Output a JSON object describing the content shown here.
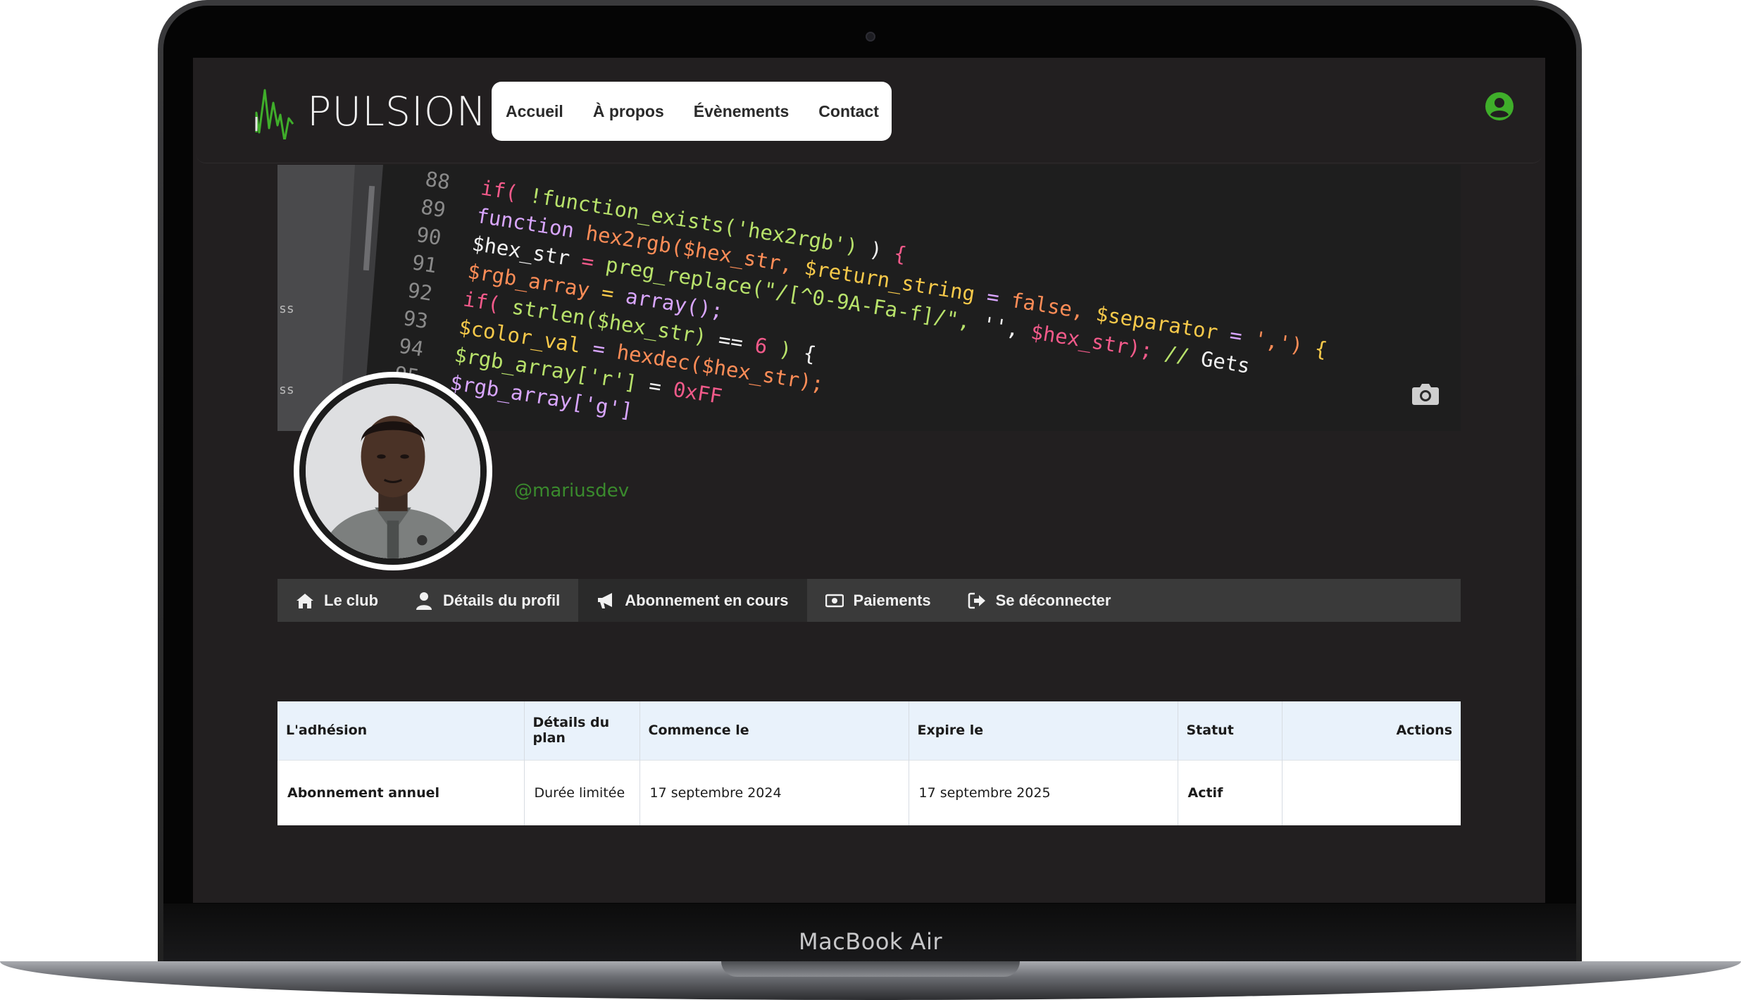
{
  "device": {
    "label": "MacBook Air"
  },
  "brand": {
    "logo_text": "PULSION",
    "accent_color": "#3fae2a"
  },
  "nav": {
    "items": [
      "Accueil",
      "À propos",
      "Évènements",
      "Contact"
    ],
    "user_icon": "user-circle-icon"
  },
  "banner": {
    "camera_icon": "camera-icon",
    "code_lines": [
      {
        "n": "88",
        "t": "if( !function_exists('hex2rgb') ) {"
      },
      {
        "n": "89",
        "t": "  function hex2rgb($hex_str, $return_string = false, $separator = ',') {"
      },
      {
        "n": "90",
        "t": "    $hex_str = preg_replace(\"/[^0-9A-Fa-f]/\", '', $hex_str); // Gets"
      },
      {
        "n": "91",
        "t": "    $rgb_array = array();"
      },
      {
        "n": "92",
        "t": "    if( strlen($hex_str) == 6 ) {"
      },
      {
        "n": "93",
        "t": "      $color_val = hexdec($hex_str);"
      },
      {
        "n": "94",
        "t": "      $rgb_array['r'] = 0xFF"
      },
      {
        "n": "95",
        "t": "      $rgb_array['g']"
      }
    ]
  },
  "profile": {
    "handle": "@mariusdev"
  },
  "tabs": [
    {
      "label": "Le club",
      "icon": "home-icon"
    },
    {
      "label": "Détails du profil",
      "icon": "user-icon"
    },
    {
      "label": "Abonnement en cours",
      "icon": "megaphone-icon",
      "active": true
    },
    {
      "label": "Paiements",
      "icon": "money-icon"
    },
    {
      "label": "Se déconnecter",
      "icon": "logout-icon"
    }
  ],
  "table": {
    "headers": [
      "L'adhésion",
      "Détails du plan",
      "Commence le",
      "Expire le",
      "Statut",
      "Actions"
    ],
    "rows": [
      [
        "Abonnement annuel",
        "Durée limitée",
        "17 septembre 2024",
        "17 septembre 2025",
        "Actif",
        ""
      ]
    ]
  }
}
